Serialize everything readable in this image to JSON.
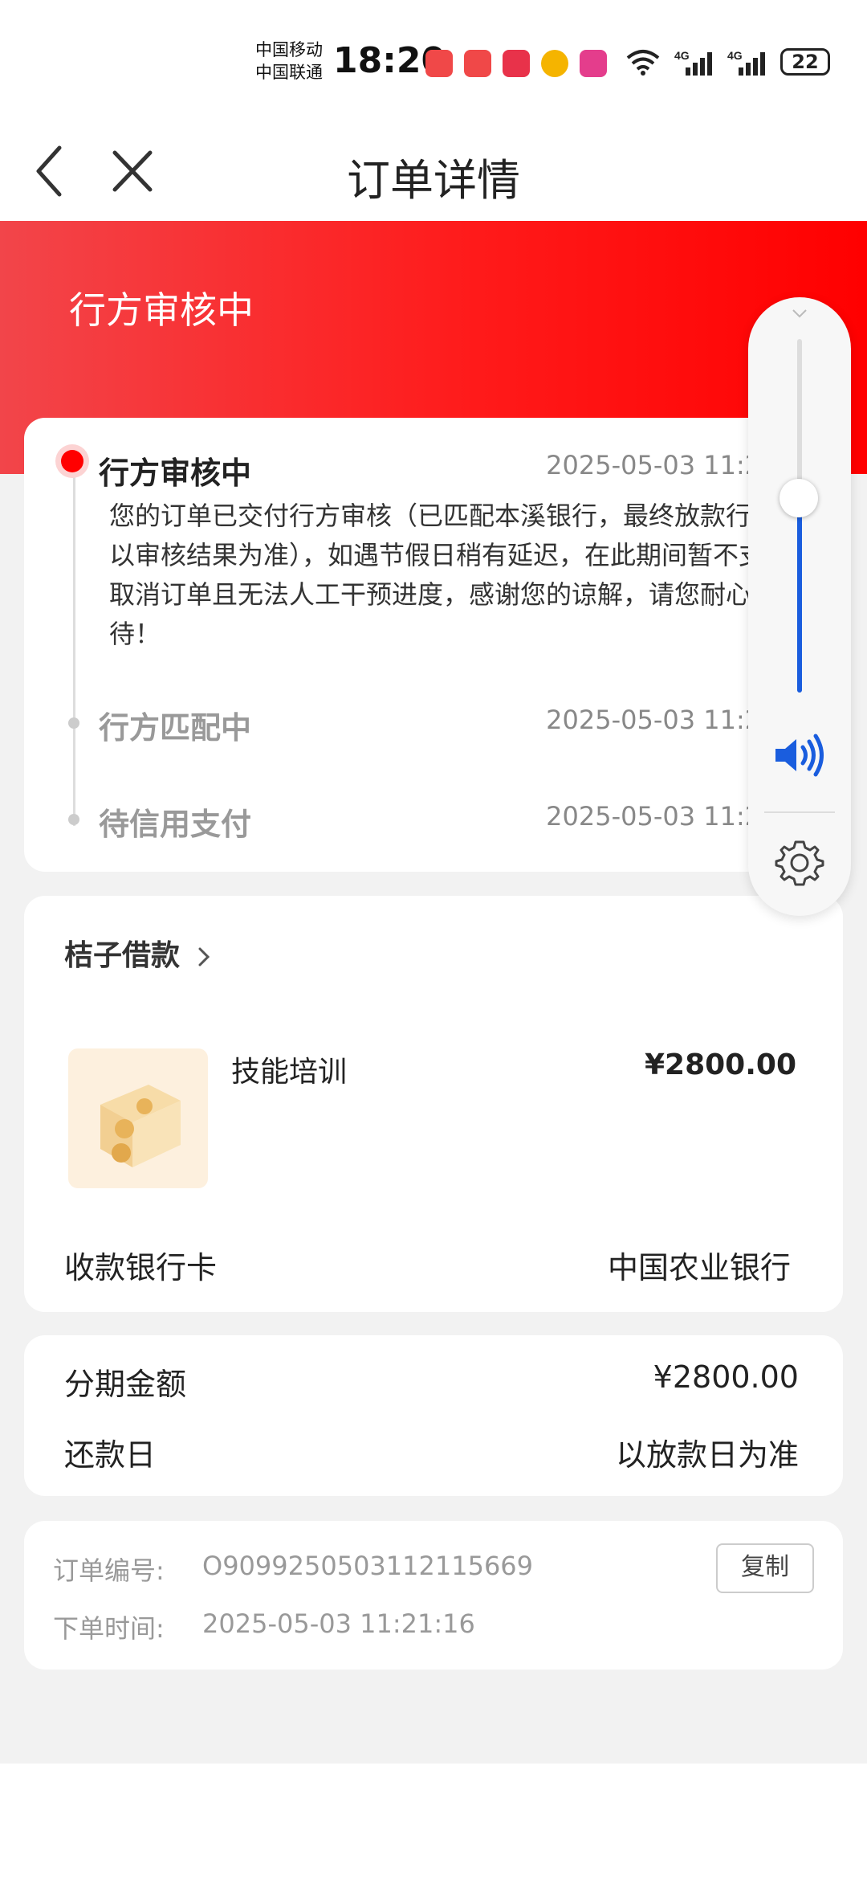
{
  "status_bar": {
    "carrier1": "中国移动",
    "carrier2": "中国联通",
    "time": "18:20",
    "battery": "22",
    "net1": "4G",
    "net2": "4G",
    "wifi": "6"
  },
  "nav": {
    "title": "订单详情"
  },
  "banner": {
    "status": "行方审核中"
  },
  "timeline": [
    {
      "title": "行方审核中",
      "time": "2025-05-03 11:21:57",
      "desc": "您的订单已交付行方审核（已匹配本溪银行，最终放款行方以审核结果为准），如遇节假日稍有延迟，在此期间暂不支持取消订单且无法人工干预进度，感谢您的谅解，请您耐心等待！"
    },
    {
      "title": "行方匹配中",
      "time": "2025-05-03 11:21:28"
    },
    {
      "title": "待信用支付",
      "time": "2025-05-03 11:21:16"
    }
  ],
  "product": {
    "merchant": "桔子借款",
    "name": "技能培训",
    "price": "¥2800.00",
    "bank_label": "收款银行卡",
    "bank_value": "中国农业银行"
  },
  "installment": {
    "amount_label": "分期金额",
    "amount_value": "¥2800.00",
    "repay_label": "还款日",
    "repay_value": "以放款日为准"
  },
  "order_info": {
    "no_label": "订单编号:",
    "no_value": "O9099250503112115669",
    "time_label": "下单时间:",
    "time_value": "2025-05-03 11:21:16",
    "copy_label": "复制"
  },
  "volume": {
    "level": 0.55
  },
  "colors": {
    "accent_red": "#ff1a1a",
    "volume_blue": "#1a5dde"
  }
}
